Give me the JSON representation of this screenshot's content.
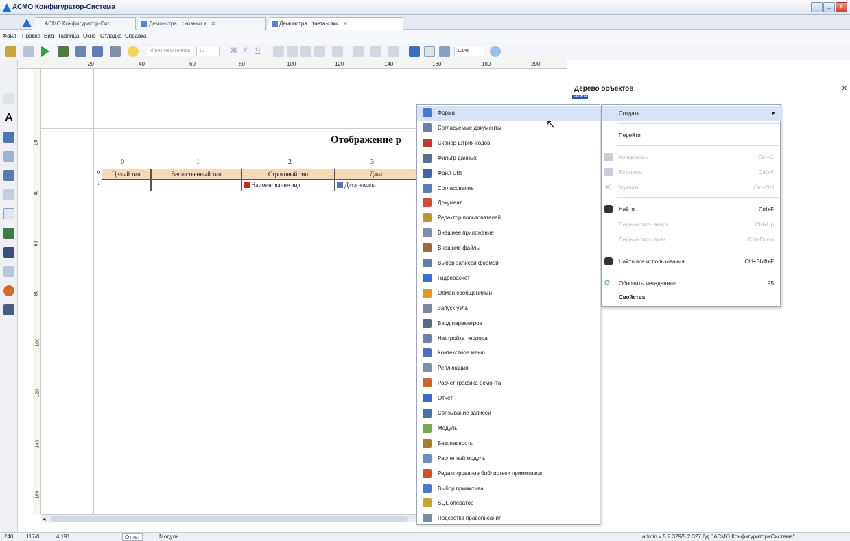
{
  "window": {
    "title": "АСМО Конфигуратор-Система",
    "min": "_",
    "max": "□",
    "close": "✕"
  },
  "tabs": [
    {
      "label": "АСМО Конфигуратор-Сис"
    },
    {
      "label": "Демонстра...сновных к",
      "close": "✕"
    },
    {
      "label": "Демонстра...тчета-спис",
      "close": "✕"
    }
  ],
  "menu": [
    "Файл",
    "Правка",
    "Вид",
    "Таблица",
    "Окно",
    "Отладка",
    "Справка"
  ],
  "toolbar": {
    "font": "Times New Roman",
    "size": "10",
    "zoom": "100%",
    "bold": "Ж",
    "italic": "К",
    "underline": "Ч"
  },
  "ruler_h": [
    "20",
    "40",
    "60",
    "80",
    "100",
    "120",
    "140",
    "160",
    "180",
    "200"
  ],
  "ruler_v": [
    "20",
    "40",
    "60",
    "80",
    "100",
    "120",
    "140",
    "160"
  ],
  "report": {
    "title": "Отображение р",
    "col_numbers": [
      "0",
      "1",
      "2",
      "3"
    ],
    "headers": [
      "Целый тип",
      "Вещественный тип",
      "Строковый тип",
      "Дата"
    ],
    "row": [
      "",
      "",
      "Наименование вид",
      "Дата начала"
    ],
    "row_index": "1",
    "header_index": "0"
  },
  "right_panel": {
    "title": "Дерево объектов",
    "close": "✕",
    "node": "Регион"
  },
  "context_menu": [
    {
      "label": "Форма",
      "color": "#4a7ac6"
    },
    {
      "label": "Согласуемые документы",
      "color": "#6b7fa6"
    },
    {
      "label": "Сканер штрих-кодов",
      "color": "#c23a2a"
    },
    {
      "label": "Фильтр данных",
      "color": "#5a6e8e"
    },
    {
      "label": "Файл DBF",
      "color": "#4566a5"
    },
    {
      "label": "Согласование",
      "color": "#5b7fb5"
    },
    {
      "label": "Документ",
      "color": "#d44a3a"
    },
    {
      "label": "Редактор пользователей",
      "color": "#b9992a"
    },
    {
      "label": "Внешнее приложение",
      "color": "#7b8fb0"
    },
    {
      "label": "Внешние файлы",
      "color": "#9a6b3b"
    },
    {
      "label": "Выбор записей формой",
      "color": "#5f7fa8"
    },
    {
      "label": "Гидрорасчет",
      "color": "#3b6fd1"
    },
    {
      "label": "Обмен сообщениями",
      "color": "#e09a2c"
    },
    {
      "label": "Запуск узла",
      "color": "#7a86a0"
    },
    {
      "label": "Ввод параметров",
      "color": "#5a6a85"
    },
    {
      "label": "Настройка периода",
      "color": "#6982ad"
    },
    {
      "label": "Контекстное меню",
      "color": "#4e70b0"
    },
    {
      "label": "Репликация",
      "color": "#7f8ea8"
    },
    {
      "label": "Расчет графика ремонта",
      "color": "#c9662d"
    },
    {
      "label": "Отчет",
      "color": "#3b6bc4"
    },
    {
      "label": "Связывание записей",
      "color": "#4c6fa9"
    },
    {
      "label": "Модуль",
      "color": "#7aa65a"
    },
    {
      "label": "Безопасность",
      "color": "#a37d32"
    },
    {
      "label": "Расчетный модуль",
      "color": "#6f8bc2"
    },
    {
      "label": "Редактирование библиотеки примитивов",
      "color": "#d2502f"
    },
    {
      "label": "Выбор примитива",
      "color": "#4b7bc8"
    },
    {
      "label": "SQL оператор",
      "color": "#c8a23b"
    },
    {
      "label": "Подсветка правописания",
      "color": "#7c8aa3"
    }
  ],
  "submenu": {
    "create": "Создать",
    "goto": "Перейти",
    "copy": "Копировать",
    "copy_sc": "Ctrl+C",
    "paste": "Вставить",
    "paste_sc": "Ctrl+V",
    "delete": "Удалить",
    "delete_sc": "Ctrl+Del",
    "find": "Найти",
    "find_sc": "Ctrl+F",
    "move_up": "Переместить вверх",
    "move_up_sc": "Ctrl+Up",
    "move_down": "Переместить вниз",
    "move_down_sc": "Ctrl+Down",
    "find_all": "Найти все использования",
    "find_all_sc": "Ctrl+Shift+F",
    "refresh": "Обновить метаданные",
    "refresh_sc": "F5",
    "props": "Свойства"
  },
  "status": {
    "pos1": "240",
    "pos2": "117/0",
    "pos3": "4.191",
    "tab1": "Отчет",
    "tab2": "Модуль",
    "right": "admin v 5.2.329/5.2.327 бд: \"АСМО Конфигуратор+Система\""
  },
  "colors": {
    "accent": "#d6e3f5",
    "header_bg": "#f5d9b8"
  }
}
